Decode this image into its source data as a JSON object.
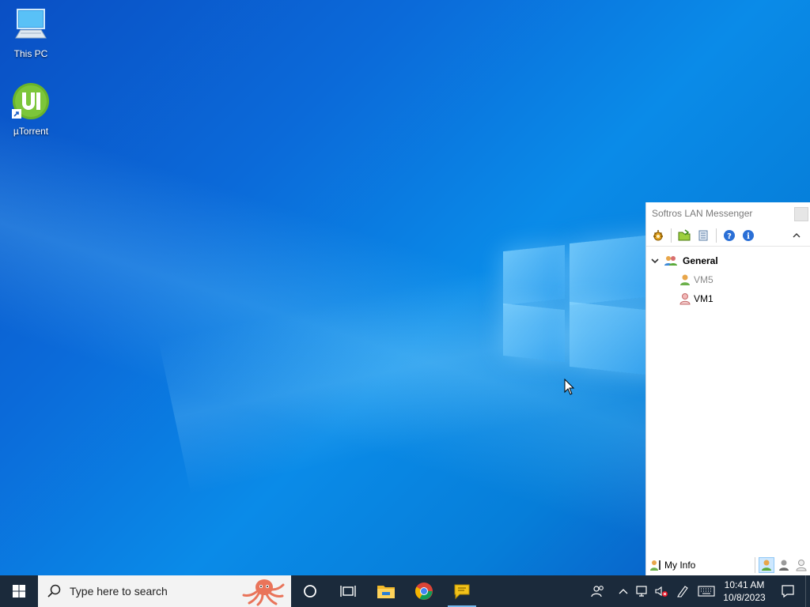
{
  "desktop": {
    "icons": [
      {
        "label": "This PC",
        "icon": "this-pc-icon"
      },
      {
        "label": "µTorrent",
        "icon": "utorrent-icon"
      }
    ]
  },
  "messenger": {
    "title": "Softros LAN Messenger",
    "toolbar": [
      "settings-icon",
      "open-folder-icon",
      "history-icon",
      "help-icon",
      "info-icon"
    ],
    "groups": [
      {
        "name": "General",
        "expanded": true,
        "users": [
          {
            "name": "VM5",
            "status": "offline"
          },
          {
            "name": "VM1",
            "status": "online"
          }
        ]
      }
    ],
    "status_bar": {
      "my_info_label": "My Info",
      "status_buttons": [
        "available-status-icon",
        "away-status-icon",
        "offline-status-icon"
      ],
      "active_status": "available"
    }
  },
  "taskbar": {
    "search_placeholder": "Type here to search",
    "pinned": [
      "cortana-icon",
      "task-view-icon",
      "file-explorer-icon",
      "chrome-icon",
      "softros-messenger-icon"
    ],
    "tray": [
      "people-icon",
      "chevron-up-icon",
      "volume-muted-icon",
      "network-icon",
      "pen-icon",
      "keyboard-icon"
    ],
    "clock": {
      "time": "10:41 AM",
      "date": "10/8/2023"
    }
  },
  "colors": {
    "taskbar": "#1b2a3b",
    "accent": "#76b9ed",
    "wallpaper_blue": "#0a8be8"
  }
}
